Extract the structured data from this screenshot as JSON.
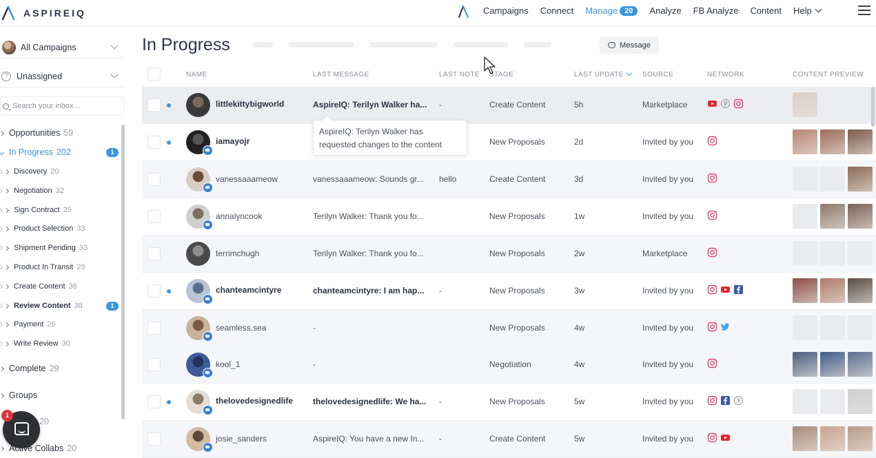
{
  "app": {
    "brand": "ASPIREIQ",
    "accent": "#3996e0"
  },
  "nav": {
    "items": [
      {
        "label": "Campaigns"
      },
      {
        "label": "Connect"
      },
      {
        "label": "Manage",
        "badge": "20",
        "active": true
      },
      {
        "label": "Analyze"
      },
      {
        "label": "FB Analyze"
      },
      {
        "label": "Content"
      },
      {
        "label": "Help",
        "dropdown": true
      }
    ],
    "menu_icon": "hamburger-icon"
  },
  "sidebar": {
    "campaign_select": "All Campaigns",
    "assignee_select": "Unassigned",
    "search_placeholder": "Search your inbox...",
    "tree": [
      {
        "label": "Opportunities",
        "count": "59",
        "level": 0
      },
      {
        "label": "In Progress",
        "count": "202",
        "level": 0,
        "active": true,
        "badge": "1"
      },
      {
        "label": "Discovery",
        "count": "20",
        "level": 1
      },
      {
        "label": "Negotiation",
        "count": "32",
        "level": 1
      },
      {
        "label": "Sign Contract",
        "count": "25",
        "level": 1
      },
      {
        "label": "Product Selection",
        "count": "33",
        "level": 1
      },
      {
        "label": "Shipment Pending",
        "count": "33",
        "level": 1
      },
      {
        "label": "Product In Transit",
        "count": "29",
        "level": 1
      },
      {
        "label": "Create Content",
        "count": "36",
        "level": 1
      },
      {
        "label": "Review Content",
        "count": "38",
        "level": 1,
        "bold": true,
        "badge": "1"
      },
      {
        "label": "Payment",
        "count": "26",
        "level": 1
      },
      {
        "label": "Write Review",
        "count": "30",
        "level": 1
      },
      {
        "label": "Complete",
        "count": "29",
        "level": 0
      },
      {
        "label": "Groups",
        "count": "",
        "level": 0
      },
      {
        "label": "",
        "count": "20",
        "level": 0
      },
      {
        "label": "Active Collabs",
        "count": "20",
        "level": 0
      }
    ],
    "chat_badge": "1"
  },
  "main": {
    "title": "In Progress",
    "message_button": "Message",
    "columns": [
      "NAME",
      "LAST MESSAGE",
      "LAST NOTE",
      "STAGE",
      "LAST UPDATE",
      "SOURCE",
      "NETWORK",
      "CONTENT PREVIEW"
    ],
    "tooltip": "AspireIQ: Terilyn Walker has requested changes to the content",
    "rows": [
      {
        "name": "littlekittybigworld",
        "bold": true,
        "unread": true,
        "message": "AspireIQ: Terilyn Walker ha...",
        "note": "-",
        "stage": "Create Content",
        "updated": "5h",
        "source": "Marketplace",
        "networks": [
          "youtube-icon",
          "pinterest-icon",
          "instagram-icon"
        ]
      },
      {
        "name": "iamayojr",
        "bold": true,
        "unread": true,
        "message": "",
        "note": "",
        "stage": "New Proposals",
        "updated": "2d",
        "source": "Invited by you",
        "networks": [
          "instagram-icon"
        ]
      },
      {
        "name": "vanessaaameow",
        "bold": false,
        "unread": false,
        "message": "vanessaaameow: Sounds gr...",
        "note": "hello",
        "stage": "Create Content",
        "updated": "3d",
        "source": "Invited by you",
        "networks": [
          "instagram-icon"
        ]
      },
      {
        "name": "annalyncook",
        "bold": false,
        "unread": false,
        "message": "Terilyn Walker: Thank you fo...",
        "note": "",
        "stage": "New Proposals",
        "updated": "1w",
        "source": "Invited by you",
        "networks": [
          "instagram-icon"
        ]
      },
      {
        "name": "terrimchugh",
        "bold": false,
        "unread": false,
        "message": "Terilyn Walker: Thank you fo...",
        "note": "",
        "stage": "New Proposals",
        "updated": "2w",
        "source": "Marketplace",
        "networks": [
          "instagram-icon"
        ]
      },
      {
        "name": "chanteamcintyre",
        "bold": true,
        "unread": true,
        "message": "chanteamcintyre: I am hap...",
        "note": "-",
        "stage": "New Proposals",
        "updated": "3w",
        "source": "Invited by you",
        "networks": [
          "instagram-icon",
          "youtube-icon",
          "facebook-icon"
        ]
      },
      {
        "name": "seamless.sea",
        "bold": false,
        "unread": false,
        "message": "-",
        "note": "",
        "stage": "New Proposals",
        "updated": "4w",
        "source": "Invited by you",
        "networks": [
          "instagram-icon",
          "twitter-icon"
        ]
      },
      {
        "name": "kool_1",
        "bold": false,
        "unread": false,
        "message": "-",
        "note": "",
        "stage": "Negotiation",
        "updated": "4w",
        "source": "Invited by you",
        "networks": [
          "instagram-icon"
        ]
      },
      {
        "name": "thelovedesignedlife",
        "bold": true,
        "unread": true,
        "message": "thelovedesignedlife: We ha...",
        "note": "-",
        "stage": "New Proposals",
        "updated": "5w",
        "source": "Invited by you",
        "networks": [
          "instagram-icon",
          "facebook-icon",
          "pinterest-icon"
        ]
      },
      {
        "name": "josie_sanders",
        "bold": false,
        "unread": false,
        "message": "AspireIQ: You have a new In...",
        "note": "-",
        "stage": "Create Content",
        "updated": "5w",
        "source": "Invited by you",
        "networks": [
          "instagram-icon",
          "youtube-icon"
        ]
      }
    ]
  }
}
